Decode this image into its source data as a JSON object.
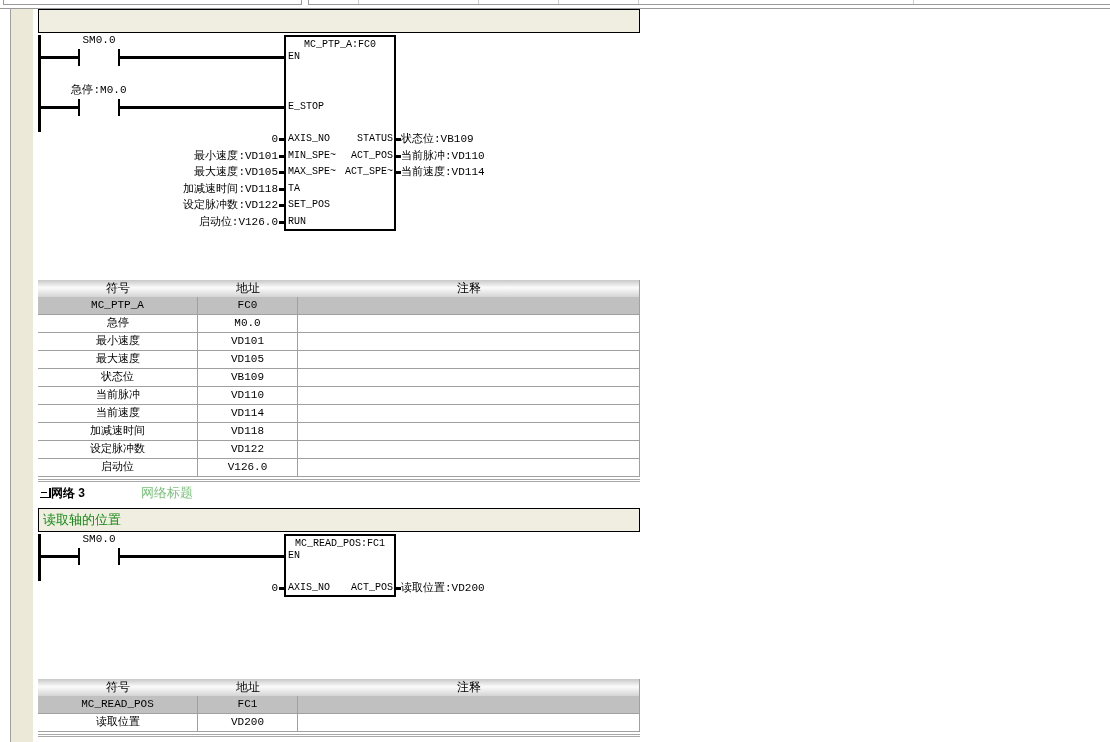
{
  "networks": [
    {
      "ladder": {
        "block_title": "MC_PTP_A:FC0",
        "rows": [
          {
            "kind": "contact",
            "contact": "SM0.0",
            "pin": "EN"
          },
          {
            "kind": "contact",
            "contact": "急停:M0.0",
            "pin": "E_STOP"
          },
          {
            "kind": "param",
            "value": "0",
            "pin": "AXIS_NO",
            "out_pin": "STATUS",
            "out_value": "状态位:VB109"
          },
          {
            "kind": "param",
            "value": "最小速度:VD101",
            "pin": "MIN_SPE~",
            "out_pin": "ACT_POS",
            "out_value": "当前脉冲:VD110"
          },
          {
            "kind": "param",
            "value": "最大速度:VD105",
            "pin": "MAX_SPE~",
            "out_pin": "ACT_SPE~",
            "out_value": "当前速度:VD114"
          },
          {
            "kind": "param",
            "value": "加减速时间:VD118",
            "pin": "TA"
          },
          {
            "kind": "param",
            "value": "设定脉冲数:VD122",
            "pin": "SET_POS"
          },
          {
            "kind": "param",
            "value": "启动位:V126.0",
            "pin": "RUN"
          }
        ]
      },
      "symbol_table": {
        "columns": [
          "符号",
          "地址",
          "注释"
        ],
        "rows": [
          {
            "kind": "block",
            "symbol": "MC_PTP_A",
            "address": "FC0"
          },
          {
            "kind": "operand",
            "symbol": "急停",
            "address": "M0.0"
          },
          {
            "kind": "operand",
            "symbol": "最小速度",
            "address": "VD101"
          },
          {
            "kind": "operand",
            "symbol": "最大速度",
            "address": "VD105"
          },
          {
            "kind": "operand",
            "symbol": "状态位",
            "address": "VB109"
          },
          {
            "kind": "operand",
            "symbol": "当前脉冲",
            "address": "VD110"
          },
          {
            "kind": "operand",
            "symbol": "当前速度",
            "address": "VD114"
          },
          {
            "kind": "operand",
            "symbol": "加减速时间",
            "address": "VD118"
          },
          {
            "kind": "operand",
            "symbol": "设定脉冲数",
            "address": "VD122"
          },
          {
            "kind": "operand",
            "symbol": "启动位",
            "address": "V126.0"
          }
        ]
      }
    },
    {
      "title": "网络 3",
      "expanded": true,
      "placeholder": "网络标题",
      "comment": "读取轴的位置",
      "ladder": {
        "block_title": "MC_READ_POS:FC1",
        "rows": [
          {
            "kind": "contact",
            "contact": "SM0.0",
            "pin": "EN"
          },
          {
            "kind": "param",
            "value": "0",
            "pin": "AXIS_NO",
            "out_pin": "ACT_POS",
            "out_value": "读取位置:VD200"
          }
        ]
      },
      "symbol_table": {
        "columns": [
          "符号",
          "地址",
          "注释"
        ],
        "rows": [
          {
            "kind": "block",
            "symbol": "MC_READ_POS",
            "address": "FC1"
          },
          {
            "kind": "operand",
            "symbol": "读取位置",
            "address": "VD200"
          }
        ]
      }
    }
  ]
}
